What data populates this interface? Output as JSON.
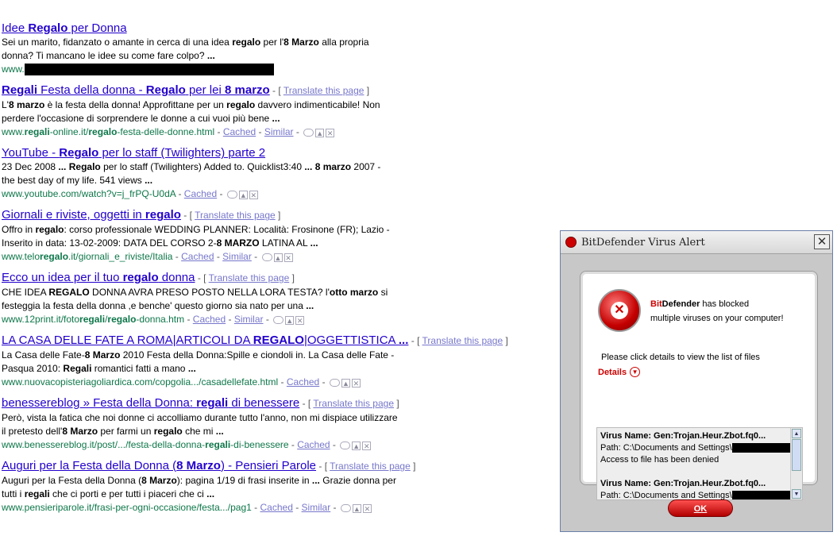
{
  "results": [
    {
      "title": [
        {
          "t": "Idee ",
          "b": false
        },
        {
          "t": "Regalo",
          "b": true
        },
        {
          "t": " per Donna",
          "b": false
        }
      ],
      "translate": false,
      "snippet": [
        [
          {
            "t": "Sei un marito, fidanzato o amante in cerca di una idea ",
            "b": false
          },
          {
            "t": "regalo",
            "b": true
          },
          {
            "t": " per l'",
            "b": false
          },
          {
            "t": "8 Marzo",
            "b": true
          },
          {
            "t": " alla propria",
            "b": false
          }
        ],
        [
          {
            "t": "donna? Ti mancano le idee su come fare colpo? ",
            "b": false
          },
          {
            "t": "...",
            "b": true
          }
        ]
      ],
      "url": [
        {
          "t": "www.",
          "b": false
        }
      ],
      "redacted": true,
      "links": []
    },
    {
      "title": [
        {
          "t": "Regali",
          "b": true
        },
        {
          "t": " Festa della donna - ",
          "b": false
        },
        {
          "t": "Regalo",
          "b": true
        },
        {
          "t": " per lei ",
          "b": false
        },
        {
          "t": "8 marzo",
          "b": true
        }
      ],
      "translate": true,
      "snippet": [
        [
          {
            "t": "L'",
            "b": false
          },
          {
            "t": "8 marzo",
            "b": true
          },
          {
            "t": " è la festa della donna! Approfittane per un ",
            "b": false
          },
          {
            "t": "regalo",
            "b": true
          },
          {
            "t": " davvero indimenticabile! Non",
            "b": false
          }
        ],
        [
          {
            "t": "perdere l'occasione di sorprendere le donne a cui vuoi più bene ",
            "b": false
          },
          {
            "t": "...",
            "b": true
          }
        ]
      ],
      "url": [
        {
          "t": "www.",
          "b": false
        },
        {
          "t": "regali",
          "b": true
        },
        {
          "t": "-online.it/",
          "b": false
        },
        {
          "t": "regalo",
          "b": true
        },
        {
          "t": "-festa-delle-donne.html",
          "b": false
        }
      ],
      "links": [
        "Cached",
        "Similar"
      ],
      "icons": true
    },
    {
      "title": [
        {
          "t": "YouTube - ",
          "b": false
        },
        {
          "t": "Regalo",
          "b": true
        },
        {
          "t": " per lo staff (Twilighters) parte 2",
          "b": false
        }
      ],
      "translate": false,
      "snippet": [
        [
          {
            "t": "23 Dec 2008 ",
            "b": false
          },
          {
            "t": "...",
            "b": true
          },
          {
            "t": " ",
            "b": false
          },
          {
            "t": "Regalo",
            "b": true
          },
          {
            "t": " per lo staff (Twilighters) Added to. Quicklist3:40 ",
            "b": false
          },
          {
            "t": "...",
            "b": true
          },
          {
            "t": " ",
            "b": false
          },
          {
            "t": "8 marzo",
            "b": true
          },
          {
            "t": " 2007 -",
            "b": false
          }
        ],
        [
          {
            "t": "the best day of my life. 541 views ",
            "b": false
          },
          {
            "t": "...",
            "b": true
          }
        ]
      ],
      "url": [
        {
          "t": "www.youtube.com/watch?v=j_frPQ-U0dA",
          "b": false
        }
      ],
      "links": [
        "Cached"
      ],
      "icons": true
    },
    {
      "title": [
        {
          "t": "Giornali e riviste, oggetti in ",
          "b": false
        },
        {
          "t": "regalo",
          "b": true
        }
      ],
      "translate": true,
      "snippet": [
        [
          {
            "t": "Offro in ",
            "b": false
          },
          {
            "t": "regalo",
            "b": true
          },
          {
            "t": ": corso professionale WEDDING PLANNER: Località: Frosinone (FR); Lazio -",
            "b": false
          }
        ],
        [
          {
            "t": "Inserito in data: 13-02-2009: DATA DEL CORSO 2-",
            "b": false
          },
          {
            "t": "8 MARZO",
            "b": true
          },
          {
            "t": " LATINA AL ",
            "b": false
          },
          {
            "t": "...",
            "b": true
          }
        ]
      ],
      "url": [
        {
          "t": "www.telo",
          "b": false
        },
        {
          "t": "regalo",
          "b": true
        },
        {
          "t": ".it/giornali_e_riviste/Italia",
          "b": false
        }
      ],
      "links": [
        "Cached",
        "Similar"
      ],
      "icons": true
    },
    {
      "title": [
        {
          "t": "Ecco un idea per il tuo ",
          "b": false
        },
        {
          "t": "regalo",
          "b": true
        },
        {
          "t": " donna",
          "b": false
        }
      ],
      "translate": true,
      "snippet": [
        [
          {
            "t": "CHE IDEA ",
            "b": false
          },
          {
            "t": "REGALO",
            "b": true
          },
          {
            "t": " DONNA AVRA PRESO POSTO NELLA LORA TESTA? l'",
            "b": false
          },
          {
            "t": "otto marzo",
            "b": true
          },
          {
            "t": " si",
            "b": false
          }
        ],
        [
          {
            "t": "festeggia la festa della donna ,e benche' questo giorno sia nato per una ",
            "b": false
          },
          {
            "t": "...",
            "b": true
          }
        ]
      ],
      "url": [
        {
          "t": "www.12print.it/foto",
          "b": false
        },
        {
          "t": "regali",
          "b": true
        },
        {
          "t": "/",
          "b": false
        },
        {
          "t": "regalo",
          "b": true
        },
        {
          "t": "-donna.htm",
          "b": false
        }
      ],
      "links": [
        "Cached",
        "Similar"
      ],
      "icons": true
    },
    {
      "title": [
        {
          "t": "LA CASA DELLE FATE A ROMA|ARTICOLI DA ",
          "b": false
        },
        {
          "t": "REGALO",
          "b": true
        },
        {
          "t": "|OGGETTISTICA ",
          "b": false
        },
        {
          "t": "...",
          "b": true
        }
      ],
      "translate": true,
      "snippet": [
        [
          {
            "t": "La Casa delle Fate-",
            "b": false
          },
          {
            "t": "8 Marzo",
            "b": true
          },
          {
            "t": " 2010 Festa della Donna:Spille e ciondoli in. La Casa delle Fate -",
            "b": false
          }
        ],
        [
          {
            "t": "Pasqua 2010: ",
            "b": false
          },
          {
            "t": "Regali",
            "b": true
          },
          {
            "t": " romantici fatti a mano ",
            "b": false
          },
          {
            "t": "...",
            "b": true
          }
        ]
      ],
      "url": [
        {
          "t": "www.nuovacopisteriagoliardica.com/copgolia.../casadellefate.html",
          "b": false
        }
      ],
      "links": [
        "Cached"
      ],
      "icons": true
    },
    {
      "title": [
        {
          "t": "benessereblog » Festa della Donna: ",
          "b": false
        },
        {
          "t": "regali",
          "b": true
        },
        {
          "t": " di benessere",
          "b": false
        }
      ],
      "translate": true,
      "snippet": [
        [
          {
            "t": "Però, vista la fatica che noi donne ci accolliamo durante tutto l'anno, non mi dispiace utilizzare",
            "b": false
          }
        ],
        [
          {
            "t": "il pretesto dell'",
            "b": false
          },
          {
            "t": "8 Marzo",
            "b": true
          },
          {
            "t": " per farmi un ",
            "b": false
          },
          {
            "t": "regalo",
            "b": true
          },
          {
            "t": " che mi ",
            "b": false
          },
          {
            "t": "...",
            "b": true
          }
        ]
      ],
      "url": [
        {
          "t": "www.benessereblog.it/post/.../festa-della-donna-",
          "b": false
        },
        {
          "t": "regali",
          "b": true
        },
        {
          "t": "-di-benessere",
          "b": false
        }
      ],
      "links": [
        "Cached"
      ],
      "icons": true
    },
    {
      "title": [
        {
          "t": "Auguri per la Festa della Donna (",
          "b": false
        },
        {
          "t": "8 Marzo",
          "b": true
        },
        {
          "t": ") - Pensieri Parole",
          "b": false
        }
      ],
      "translate": true,
      "snippet": [
        [
          {
            "t": "Auguri per la Festa della Donna (",
            "b": false
          },
          {
            "t": "8 Marzo",
            "b": true
          },
          {
            "t": "): pagina 1/19 di frasi inserite in ",
            "b": false
          },
          {
            "t": "...",
            "b": true
          },
          {
            "t": " Grazie donna per",
            "b": false
          }
        ],
        [
          {
            "t": "tutti i ",
            "b": false
          },
          {
            "t": "regali",
            "b": true
          },
          {
            "t": " che ci porti e per tutti i piaceri che ci ",
            "b": false
          },
          {
            "t": "...",
            "b": true
          }
        ]
      ],
      "url": [
        {
          "t": "www.pensieriparole.it/frasi-per-ogni-occasione/festa.../pag1",
          "b": false
        }
      ],
      "links": [
        "Cached",
        "Similar"
      ],
      "icons": true
    }
  ],
  "translate_label": "Translate this page",
  "dialog": {
    "title": "BitDefender Virus Alert",
    "close": "✕",
    "brand_bit": "Bit",
    "brand_def": "Defender",
    "message_1": " has blocked",
    "message_2": "multiple viruses on your computer!",
    "hint": "Please click details to view the list of files",
    "details": "Details",
    "entries": [
      {
        "name": "Virus Name: Gen:Trojan.Heur.Zbot.fq0...",
        "path": "Path: C:\\Documents and Settings\\",
        "status": "Access to file has been denied"
      },
      {
        "name": "Virus Name: Gen:Trojan.Heur.Zbot.fq0...",
        "path": "Path: C:\\Documents and Settings\\",
        "status": ""
      }
    ],
    "ok": "OK"
  }
}
